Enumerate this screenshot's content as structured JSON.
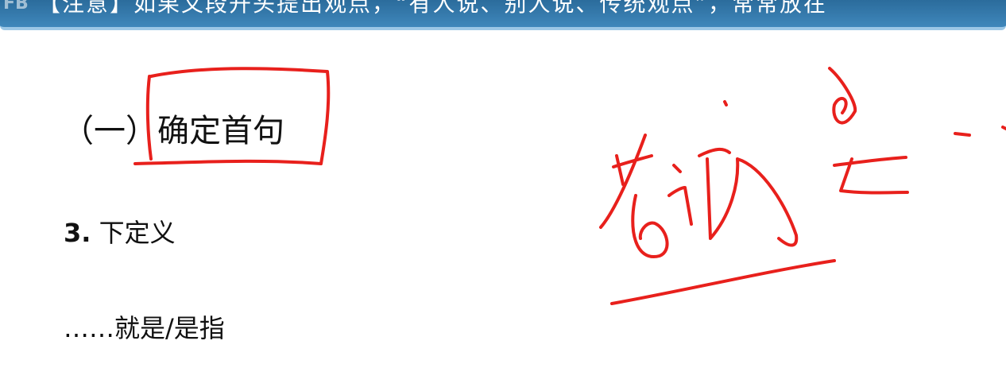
{
  "banner": {
    "logo": "FB",
    "text": "【注意】如果文段开头提出观点，“有人说、别人说、传统观点”，常常放在"
  },
  "heading": {
    "prefix": "（一）",
    "title": "确定首句"
  },
  "point": {
    "number": "3.",
    "label": "下定义"
  },
  "phrase": {
    "text": "……就是/是指"
  },
  "annotation": {
    "ink_color": "#e8201c",
    "handwriting": "名词 是…"
  }
}
